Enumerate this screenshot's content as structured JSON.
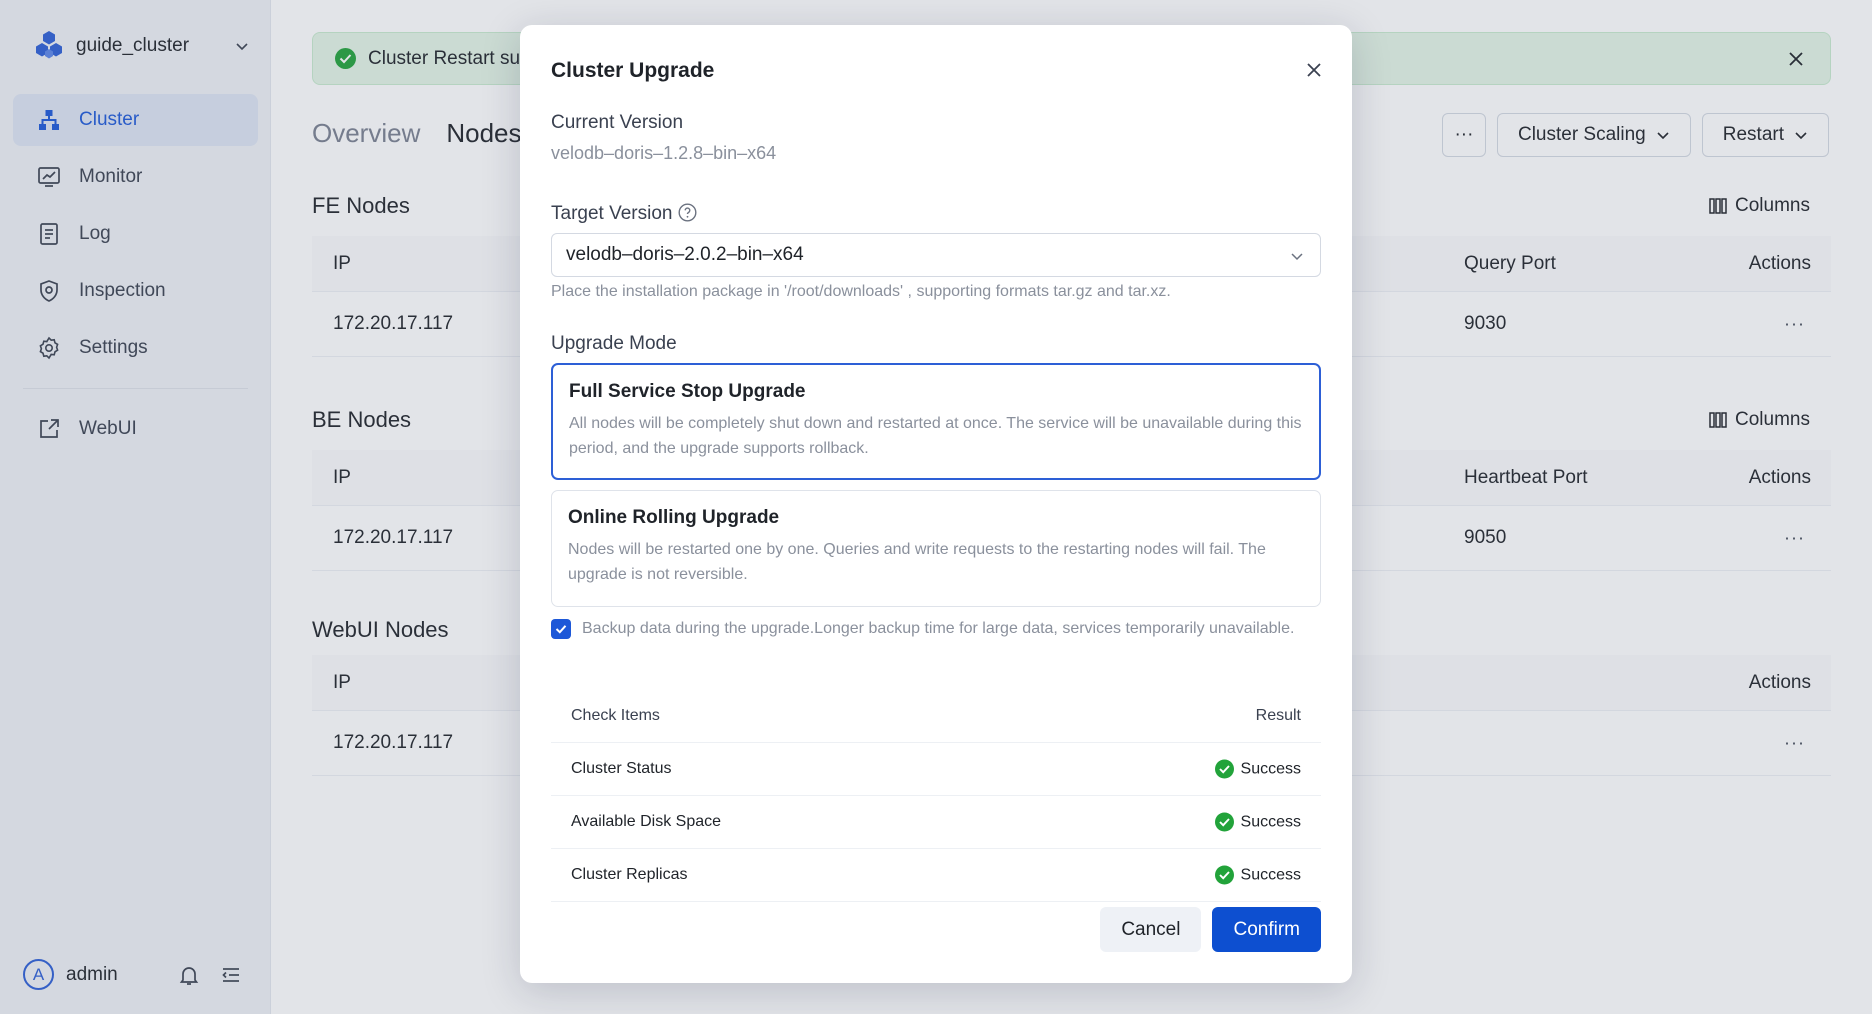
{
  "sidebar": {
    "cluster_name": "guide_cluster",
    "items": [
      {
        "label": "Cluster",
        "icon": "cluster-icon",
        "active": true
      },
      {
        "label": "Monitor",
        "icon": "monitor-icon"
      },
      {
        "label": "Log",
        "icon": "log-icon"
      },
      {
        "label": "Inspection",
        "icon": "inspection-icon"
      },
      {
        "label": "Settings",
        "icon": "settings-icon"
      }
    ],
    "webui_label": "WebUI",
    "user": {
      "avatar_letter": "A",
      "name": "admin"
    }
  },
  "main": {
    "alert_text": "Cluster Restart su",
    "tabs": [
      "Overview",
      "Nodes"
    ],
    "actions": {
      "more": "···",
      "scaling": "Cluster Scaling",
      "restart": "Restart"
    },
    "columns_label": "Columns",
    "fe": {
      "title": "FE Nodes",
      "col_ip": "IP",
      "col_port": "Query Port",
      "col_actions": "Actions",
      "rows": [
        {
          "ip": "172.20.17.117",
          "port": "9030"
        }
      ]
    },
    "be": {
      "title": "BE Nodes",
      "col_ip": "IP",
      "col_port": "Heartbeat Port",
      "col_actions": "Actions",
      "rows": [
        {
          "ip": "172.20.17.117",
          "port": "9050"
        }
      ]
    },
    "webui": {
      "title": "WebUI Nodes",
      "col_ip": "IP",
      "col_actions": "Actions",
      "rows": [
        {
          "ip": "172.20.17.117"
        }
      ]
    },
    "row_action": "···"
  },
  "modal": {
    "title": "Cluster Upgrade",
    "current_version_label": "Current Version",
    "current_version": "velodb–doris–1.2.8–bin–x64",
    "target_version_label": "Target Version",
    "target_version": "velodb–doris–2.0.2–bin–x64",
    "hint": "Place the installation package in '/root/downloads' , supporting formats tar.gz and tar.xz.",
    "upgrade_mode_label": "Upgrade Mode",
    "modes": [
      {
        "title": "Full Service Stop Upgrade",
        "desc": "All nodes will be completely shut down and restarted at once. The service will be unavailable during this period, and the upgrade supports rollback.",
        "selected": true
      },
      {
        "title": "Online Rolling Upgrade",
        "desc": "Nodes will be restarted one by one. Queries and write requests to the restarting nodes will fail. The upgrade is not reversible.",
        "selected": false
      }
    ],
    "backup": {
      "checked": true,
      "text": "Backup data during the upgrade.Longer backup time for large data, services temporarily unavailable."
    },
    "check_table": {
      "col_items": "Check Items",
      "col_result": "Result",
      "rows": [
        {
          "item": "Cluster Status",
          "result": "Success"
        },
        {
          "item": "Available Disk Space",
          "result": "Success"
        },
        {
          "item": "Cluster Replicas",
          "result": "Success"
        }
      ]
    },
    "cancel": "Cancel",
    "confirm": "Confirm"
  },
  "colors": {
    "accent": "#1d58d8",
    "success": "#22a33a",
    "primary_button": "#0d4fd0"
  }
}
